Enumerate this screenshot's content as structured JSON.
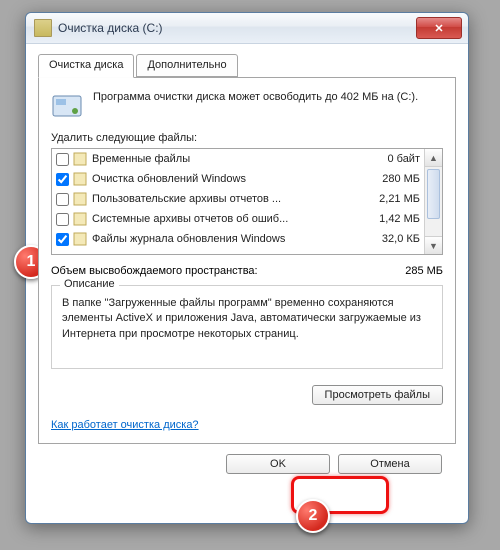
{
  "window": {
    "title": "Очистка диска (C:)"
  },
  "tabs": {
    "main": "Очистка диска",
    "advanced": "Дополнительно"
  },
  "info": {
    "text": "Программа очистки диска может освободить до 402 МБ на (C:)."
  },
  "delete_label": "Удалить следующие файлы:",
  "files": [
    {
      "label": "Временные файлы",
      "size": "0 байт",
      "checked": false
    },
    {
      "label": "Очистка обновлений Windows",
      "size": "280 МБ",
      "checked": true
    },
    {
      "label": "Пользовательские архивы отчетов ...",
      "size": "2,21 МБ",
      "checked": false
    },
    {
      "label": "Системные архивы отчетов об ошиб...",
      "size": "1,42 МБ",
      "checked": false
    },
    {
      "label": "Файлы журнала обновления Windows",
      "size": "32,0 КБ",
      "checked": true
    }
  ],
  "freespace": {
    "label": "Объем высвобождаемого пространства:",
    "value": "285 МБ"
  },
  "description": {
    "legend": "Описание",
    "text": "В папке \"Загруженные файлы программ\" временно сохраняются элементы ActiveX и приложения Java, автоматически загружаемые из Интернета при просмотре некоторых страниц."
  },
  "buttons": {
    "view_files": "Просмотреть файлы",
    "ok": "OK",
    "cancel": "Отмена"
  },
  "help_link": "Как работает очистка диска?",
  "markers": {
    "one": "1",
    "two": "2"
  }
}
